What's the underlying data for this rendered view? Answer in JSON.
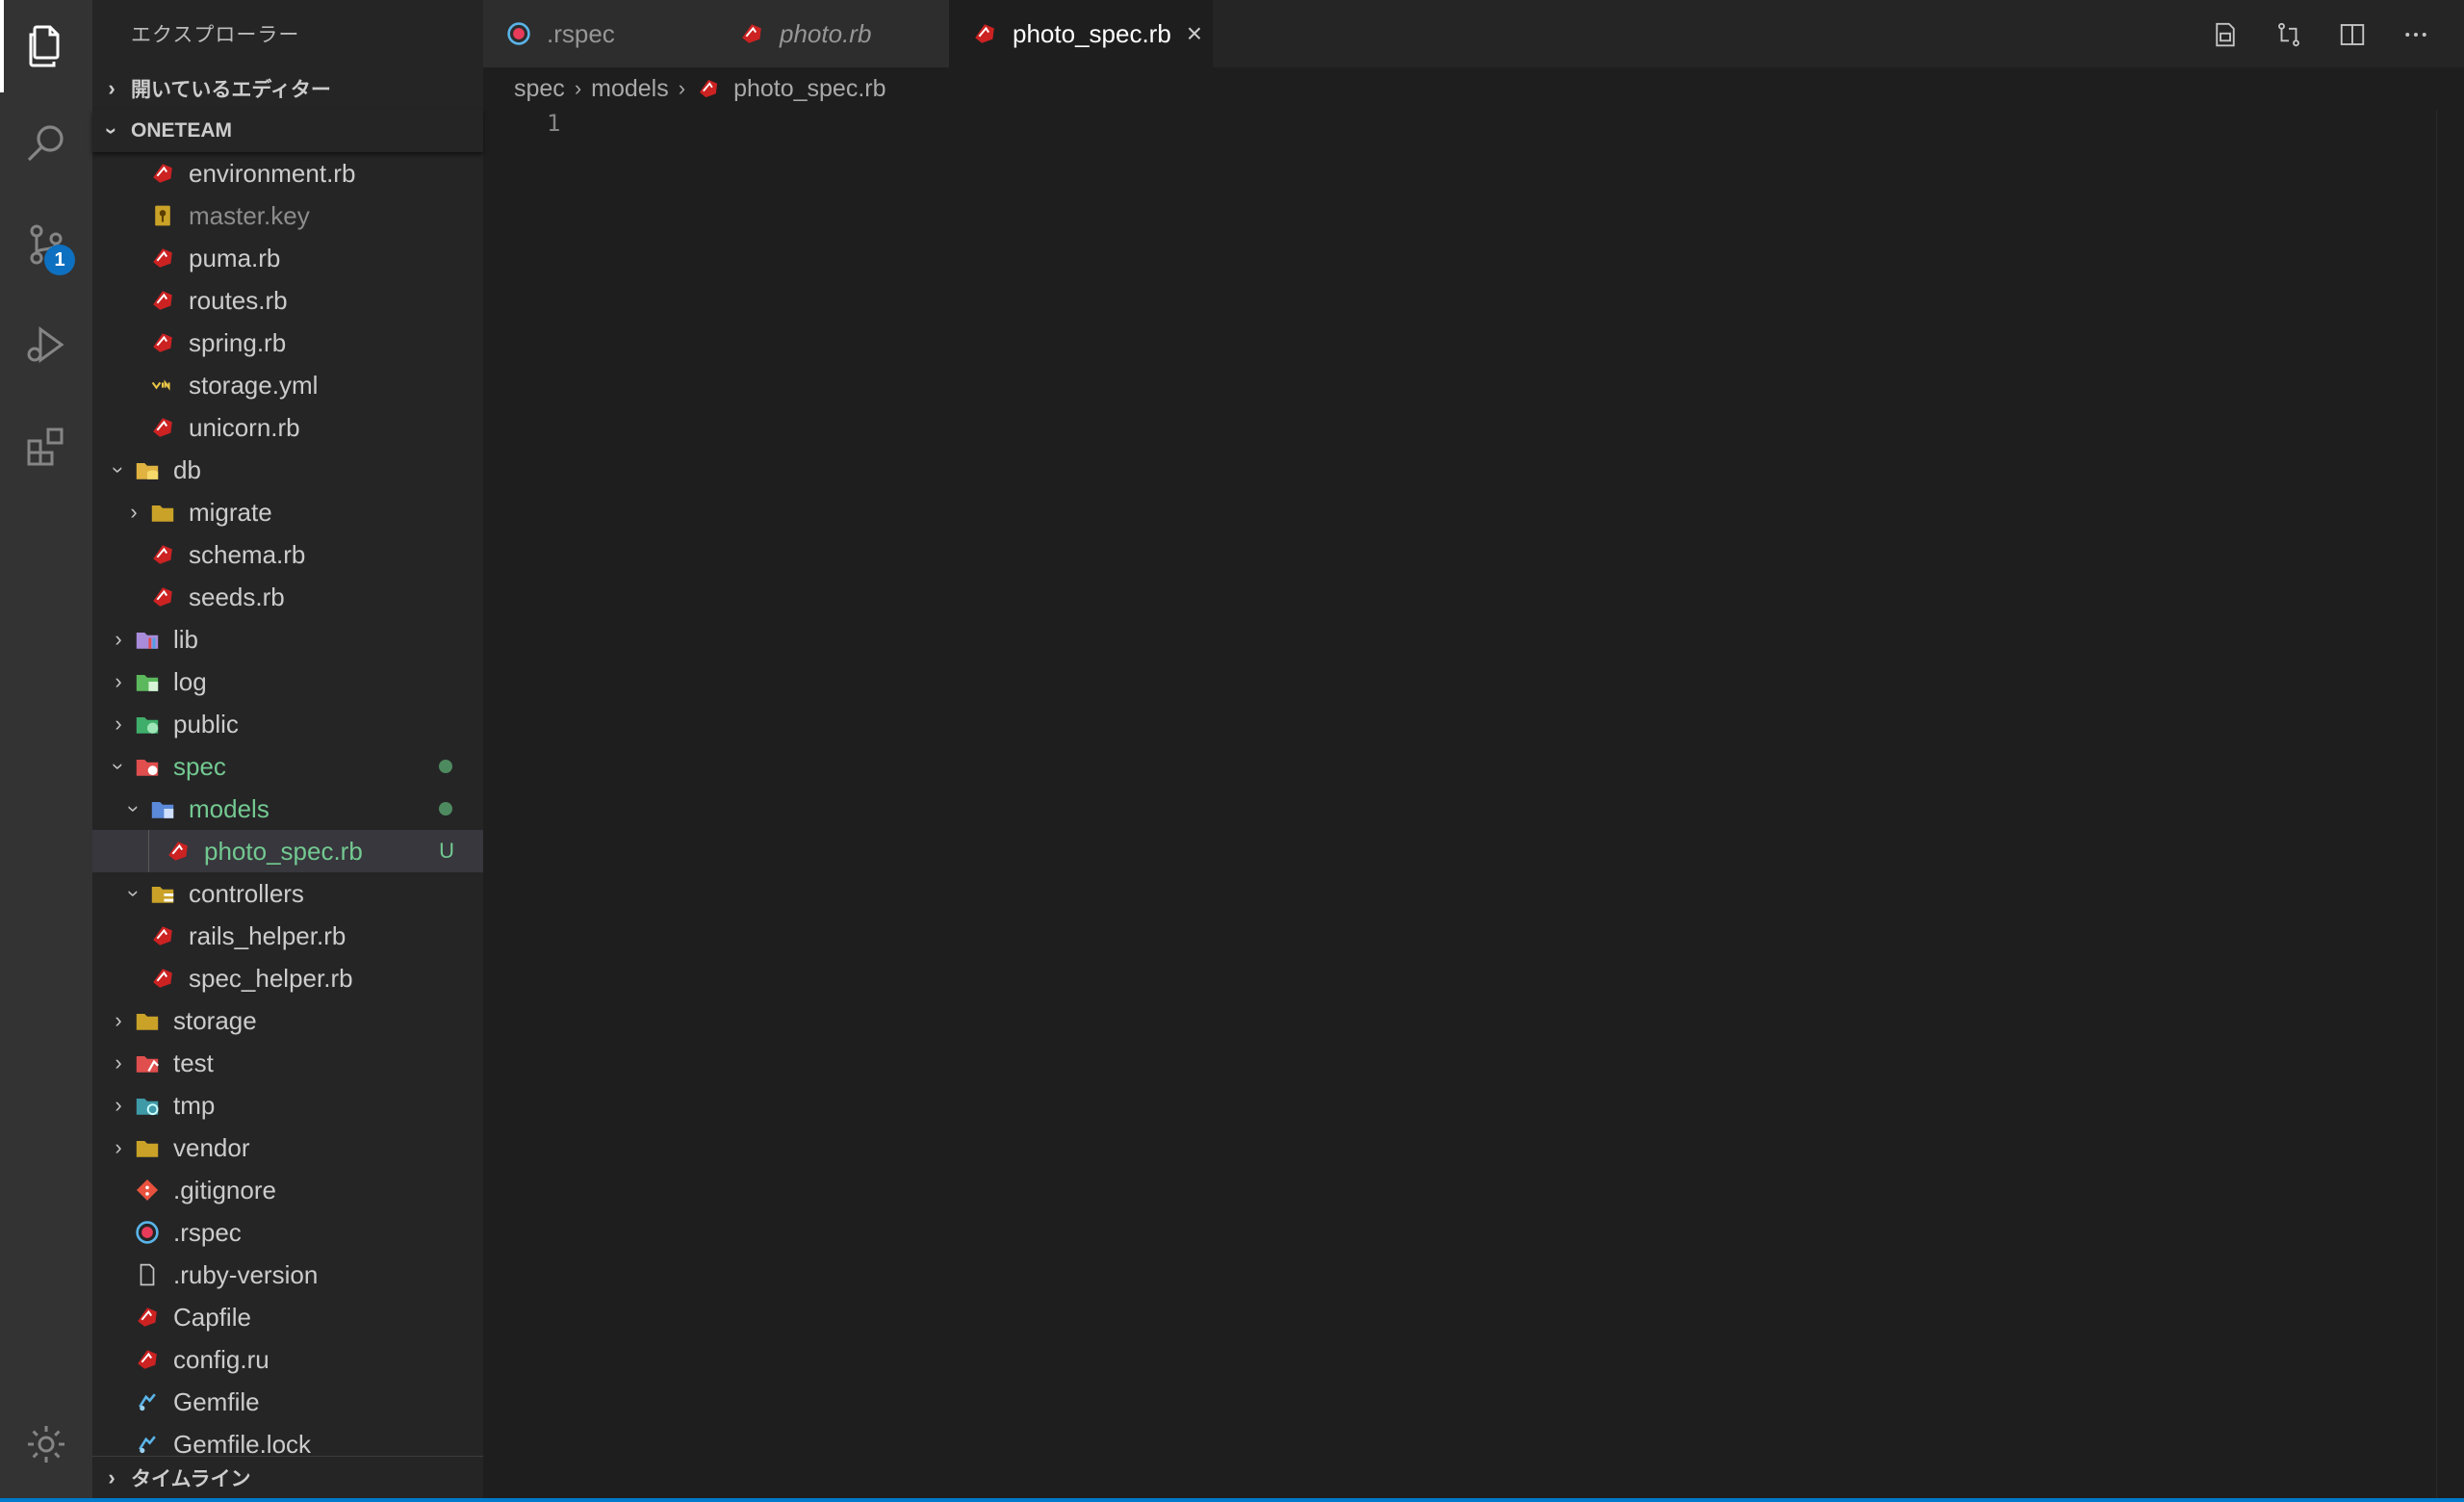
{
  "sidebar": {
    "title": "エクスプローラー",
    "open_editors": "開いているエディター",
    "workspace": "ONETEAM",
    "timeline": "タイムライン",
    "tree": [
      {
        "label": "environment.rb",
        "icon": "ruby-icon",
        "depth": 2,
        "type": "file"
      },
      {
        "label": "master.key",
        "icon": "key-icon",
        "depth": 2,
        "type": "file",
        "dim": true
      },
      {
        "label": "puma.rb",
        "icon": "ruby-icon",
        "depth": 2,
        "type": "file"
      },
      {
        "label": "routes.rb",
        "icon": "ruby-icon",
        "depth": 2,
        "type": "file"
      },
      {
        "label": "spring.rb",
        "icon": "ruby-icon",
        "depth": 2,
        "type": "file"
      },
      {
        "label": "storage.yml",
        "icon": "yaml-icon",
        "depth": 2,
        "type": "file"
      },
      {
        "label": "unicorn.rb",
        "icon": "ruby-icon",
        "depth": 2,
        "type": "file"
      },
      {
        "label": "db",
        "icon": "db-folder-icon",
        "depth": 1,
        "type": "folder",
        "open": true
      },
      {
        "label": "migrate",
        "icon": "folder-icon",
        "depth": 2,
        "type": "folder",
        "open": false
      },
      {
        "label": "schema.rb",
        "icon": "ruby-icon",
        "depth": 2,
        "type": "file"
      },
      {
        "label": "seeds.rb",
        "icon": "ruby-icon",
        "depth": 2,
        "type": "file"
      },
      {
        "label": "lib",
        "icon": "lib-folder-icon",
        "depth": 1,
        "type": "folder",
        "open": false
      },
      {
        "label": "log",
        "icon": "log-folder-icon",
        "depth": 1,
        "type": "folder",
        "open": false
      },
      {
        "label": "public",
        "icon": "public-folder-icon",
        "depth": 1,
        "type": "folder",
        "open": false
      },
      {
        "label": "spec",
        "icon": "spec-folder-icon",
        "depth": 1,
        "type": "folder",
        "open": true,
        "git": true,
        "dot": true
      },
      {
        "label": "models",
        "icon": "models-folder-icon",
        "depth": 2,
        "type": "folder",
        "open": true,
        "git": true,
        "dot": true
      },
      {
        "label": "photo_spec.rb",
        "icon": "ruby-icon",
        "depth": 3,
        "type": "file",
        "git": true,
        "status": "U",
        "selected": true
      },
      {
        "label": "controllers",
        "icon": "controllers-folder-icon",
        "depth": 2,
        "type": "folder",
        "open": true
      },
      {
        "label": "rails_helper.rb",
        "icon": "ruby-icon",
        "depth": 2,
        "type": "file"
      },
      {
        "label": "spec_helper.rb",
        "icon": "ruby-icon",
        "depth": 2,
        "type": "file"
      },
      {
        "label": "storage",
        "icon": "folder-icon",
        "depth": 1,
        "type": "folder",
        "open": false
      },
      {
        "label": "test",
        "icon": "test-folder-icon",
        "depth": 1,
        "type": "folder",
        "open": false
      },
      {
        "label": "tmp",
        "icon": "tmp-folder-icon",
        "depth": 1,
        "type": "folder",
        "open": false
      },
      {
        "label": "vendor",
        "icon": "folder-icon",
        "depth": 1,
        "type": "folder",
        "open": false
      },
      {
        "label": ".gitignore",
        "icon": "git-icon",
        "depth": 1,
        "type": "file"
      },
      {
        "label": ".rspec",
        "icon": "rspec-icon",
        "depth": 1,
        "type": "file"
      },
      {
        "label": ".ruby-version",
        "icon": "file-icon",
        "depth": 1,
        "type": "file"
      },
      {
        "label": "Capfile",
        "icon": "ruby-icon",
        "depth": 1,
        "type": "file"
      },
      {
        "label": "config.ru",
        "icon": "ruby-icon",
        "depth": 1,
        "type": "file"
      },
      {
        "label": "Gemfile",
        "icon": "gemfile-icon",
        "depth": 1,
        "type": "file"
      },
      {
        "label": "Gemfile.lock",
        "icon": "gemfile-icon",
        "depth": 1,
        "type": "file"
      }
    ]
  },
  "activity": {
    "scm_badge": "1"
  },
  "tabs": [
    {
      "label": ".rspec",
      "icon": "rspec-icon",
      "italic": false,
      "active": false
    },
    {
      "label": "photo.rb",
      "icon": "ruby-icon",
      "italic": true,
      "active": false
    },
    {
      "label": "photo_spec.rb",
      "icon": "ruby-icon",
      "italic": false,
      "active": true
    }
  ],
  "tab_close": "×",
  "breadcrumb": {
    "parts": [
      "spec",
      "models"
    ],
    "file": "photo_spec.rb",
    "separator": "›"
  },
  "editor": {
    "line_numbers": [
      "1"
    ]
  },
  "colors": {
    "accent": "#007acc",
    "git_untracked": "#73c991",
    "ruby": "#cc2222"
  }
}
